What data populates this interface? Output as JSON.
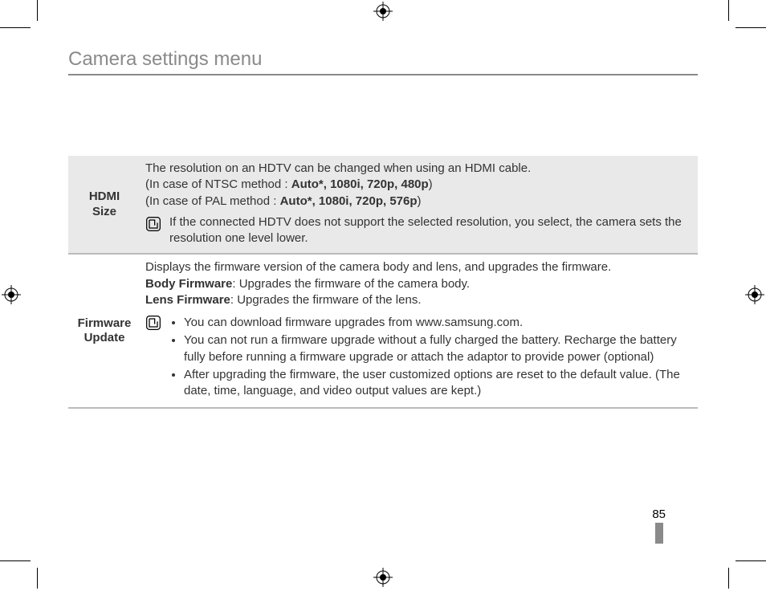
{
  "title": "Camera settings menu",
  "page_number": "85",
  "rows": {
    "hdmi": {
      "label_line1": "HDMI",
      "label_line2": "Size",
      "line1": "The resolution on an HDTV can be changed when using an HDMI cable.",
      "line2_pre": "(In case of NTSC method : ",
      "line2_bold": "Auto*, 1080i, 720p, 480p",
      "line2_post": ")",
      "line3_pre": "(In case of PAL method : ",
      "line3_bold": "Auto*, 1080i, 720p, 576p",
      "line3_post": ")",
      "note": "If the connected HDTV does not support the selected resolution, you select, the camera sets the resolution one level lower."
    },
    "firmware": {
      "label_line1": "Firmware",
      "label_line2": "Update",
      "line1": "Displays the firmware version of the camera body and lens, and upgrades the firmware.",
      "line2_bold": "Body Firmware",
      "line2_rest": ": Upgrades the firmware of the camera body.",
      "line3_bold": "Lens Firmware",
      "line3_rest": ": Upgrades the firmware of the lens.",
      "bullets": [
        "You can download firmware upgrades from www.samsung.com.",
        "You can not run a firmware upgrade without a fully charged the battery. Recharge the battery fully before running a firmware upgrade or attach the adaptor to provide power (optional)",
        "After upgrading the firmware, the user customized options are reset to the default value. (The date, time, language, and video output values are kept.)"
      ]
    }
  }
}
